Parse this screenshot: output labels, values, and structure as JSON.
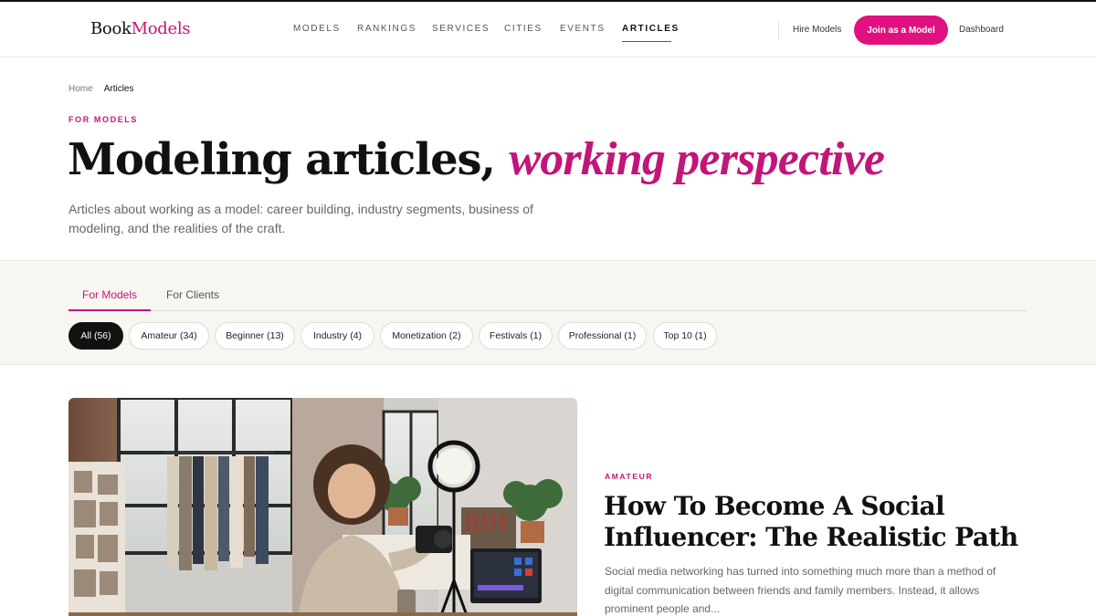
{
  "header": {
    "logo_part1": "Book",
    "logo_part2": "Models",
    "nav": [
      {
        "label": "MODELS",
        "active": false
      },
      {
        "label": "RANKINGS",
        "active": false
      },
      {
        "label": "SERVICES",
        "active": false
      },
      {
        "label": "CITIES",
        "active": false
      },
      {
        "label": "EVENTS",
        "active": false
      },
      {
        "label": "ARTICLES",
        "active": true
      }
    ],
    "hire_label": "Hire Models",
    "join_label": "Join as a Model",
    "dashboard_label": "Dashboard"
  },
  "breadcrumb": {
    "home": "Home",
    "current": "Articles"
  },
  "hero": {
    "eyebrow": "FOR MODELS",
    "title_main": "Modeling articles,",
    "title_accent": "working perspective",
    "description": "Articles about working as a model: career building, industry segments, business of modeling, and the realities of the craft."
  },
  "tabs": [
    {
      "label": "For Models",
      "active": true
    },
    {
      "label": "For Clients",
      "active": false
    }
  ],
  "filters": [
    {
      "label": "All (56)",
      "active": true
    },
    {
      "label": "Amateur (34)",
      "active": false
    },
    {
      "label": "Beginner (13)",
      "active": false
    },
    {
      "label": "Industry (4)",
      "active": false
    },
    {
      "label": "Monetization (2)",
      "active": false
    },
    {
      "label": "Festivals (1)",
      "active": false
    },
    {
      "label": "Professional (1)",
      "active": false
    },
    {
      "label": "Top 10 (1)",
      "active": false
    }
  ],
  "featured_article": {
    "category": "AMATEUR",
    "title": "How To Become A Social Influencer: The Realistic Path",
    "excerpt": "Social media networking has turned into something much more than a method of digital communication between friends and family members. Instead, it allows prominent people and..."
  },
  "colors": {
    "accent": "#e0117f",
    "accent_text": "#c2157a",
    "band": "#f7f6f0",
    "dark": "#111111"
  }
}
